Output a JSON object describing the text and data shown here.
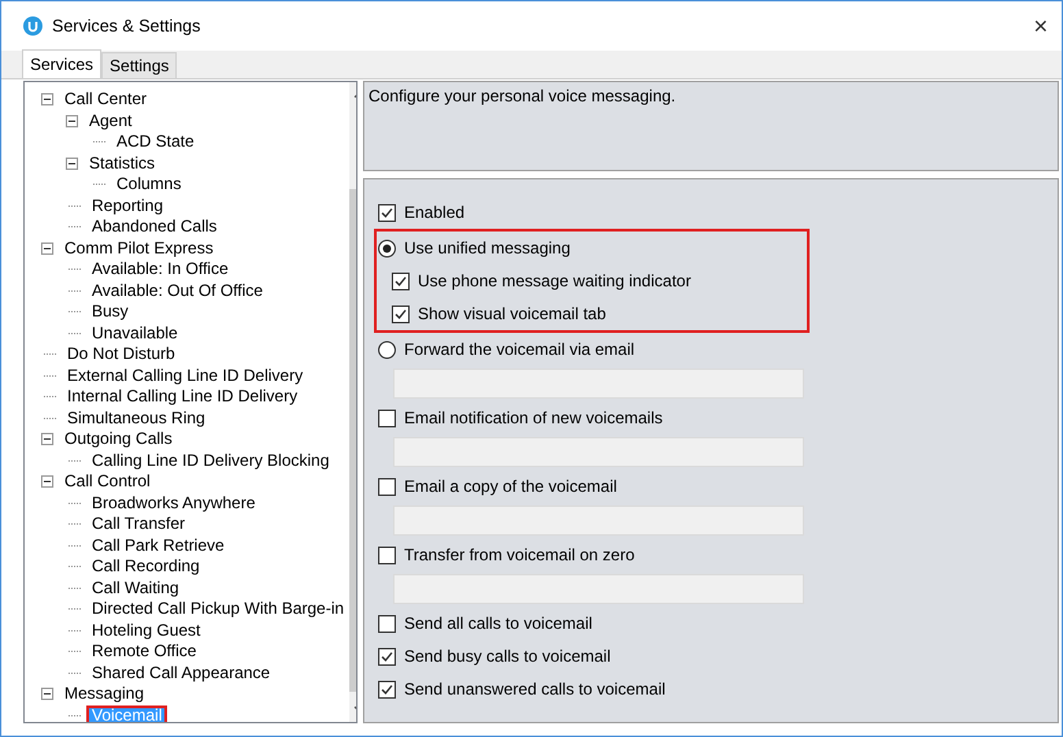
{
  "window": {
    "title": "Services & Settings",
    "close": "×"
  },
  "tabs": [
    {
      "label": "Services",
      "selected": true
    },
    {
      "label": "Settings",
      "selected": false
    }
  ],
  "tree": {
    "items": [
      {
        "children": [
          {
            "label": "Call Center",
            "selected": false,
            "expanded": true,
            "children": [
              {
                "label": "Agent",
                "selected": false,
                "expanded": true,
                "children": [
                  {
                    "label": "ACD State",
                    "selected": false
                  }
                ]
              },
              {
                "label": "Statistics",
                "selected": false,
                "expanded": true,
                "children": [
                  {
                    "label": "Columns",
                    "selected": false
                  }
                ]
              },
              {
                "label": "Reporting",
                "selected": false
              },
              {
                "label": "Abandoned Calls",
                "selected": false
              }
            ]
          },
          {
            "label": "Comm Pilot Express",
            "selected": false,
            "expanded": true,
            "children": [
              {
                "label": "Available: In Office",
                "selected": false
              },
              {
                "label": "Available: Out Of Office",
                "selected": false
              },
              {
                "label": "Busy",
                "selected": false
              },
              {
                "label": "Unavailable",
                "selected": false
              }
            ]
          },
          {
            "label": "Do Not Disturb",
            "selected": false
          },
          {
            "label": "External Calling Line ID Delivery",
            "selected": false
          },
          {
            "label": "Internal Calling Line ID Delivery",
            "selected": false
          },
          {
            "label": "Simultaneous Ring",
            "selected": false
          }
        ]
      },
      {
        "label": "Outgoing Calls",
        "selected": false,
        "expanded": true,
        "children": [
          {
            "label": "Calling Line ID Delivery Blocking",
            "selected": false
          }
        ]
      },
      {
        "label": "Call Control",
        "selected": false,
        "expanded": true,
        "children": [
          {
            "label": "Broadworks Anywhere",
            "selected": false
          },
          {
            "label": "Call Transfer",
            "selected": false
          },
          {
            "label": "Call Park Retrieve",
            "selected": false
          },
          {
            "label": "Call Recording",
            "selected": false
          },
          {
            "label": "Call Waiting",
            "selected": false
          },
          {
            "label": "Directed Call Pickup With Barge-in",
            "selected": false
          },
          {
            "label": "Hoteling Guest",
            "selected": false
          },
          {
            "label": "Remote Office",
            "selected": false
          },
          {
            "label": "Shared Call Appearance",
            "selected": false
          }
        ]
      },
      {
        "label": "Messaging",
        "selected": false,
        "expanded": true,
        "children": [
          {
            "label": "Voicemail",
            "selected": true,
            "highlighted": true
          }
        ]
      }
    ]
  },
  "description": "Configure your personal voice messaging.",
  "options": [
    {
      "kind": "checkbox",
      "label": "Enabled",
      "checked": true
    },
    {
      "kind": "group",
      "highlighted": true,
      "items": [
        {
          "kind": "radio",
          "label": "Use unified messaging",
          "selected": true
        },
        {
          "kind": "subcheckbox",
          "label": "Use phone message waiting indicator",
          "checked": true
        },
        {
          "kind": "subcheckbox",
          "label": "Show visual voicemail tab",
          "checked": true
        }
      ]
    },
    {
      "kind": "radio",
      "label": "Forward the voicemail via email",
      "selected": false
    },
    {
      "kind": "field"
    },
    {
      "kind": "checkbox",
      "label": "Email notification of new voicemails",
      "checked": false
    },
    {
      "kind": "field"
    },
    {
      "kind": "checkbox",
      "label": "Email a copy of the voicemail",
      "checked": false
    },
    {
      "kind": "field"
    },
    {
      "kind": "checkbox",
      "label": "Transfer from voicemail on zero",
      "checked": false
    },
    {
      "kind": "field"
    },
    {
      "kind": "checkbox",
      "label": "Send all calls to voicemail",
      "checked": false
    },
    {
      "kind": "checkbox",
      "label": "Send busy calls to voicemail",
      "checked": true
    },
    {
      "kind": "checkbox",
      "label": "Send unanswered calls to voicemail",
      "checked": true
    }
  ]
}
